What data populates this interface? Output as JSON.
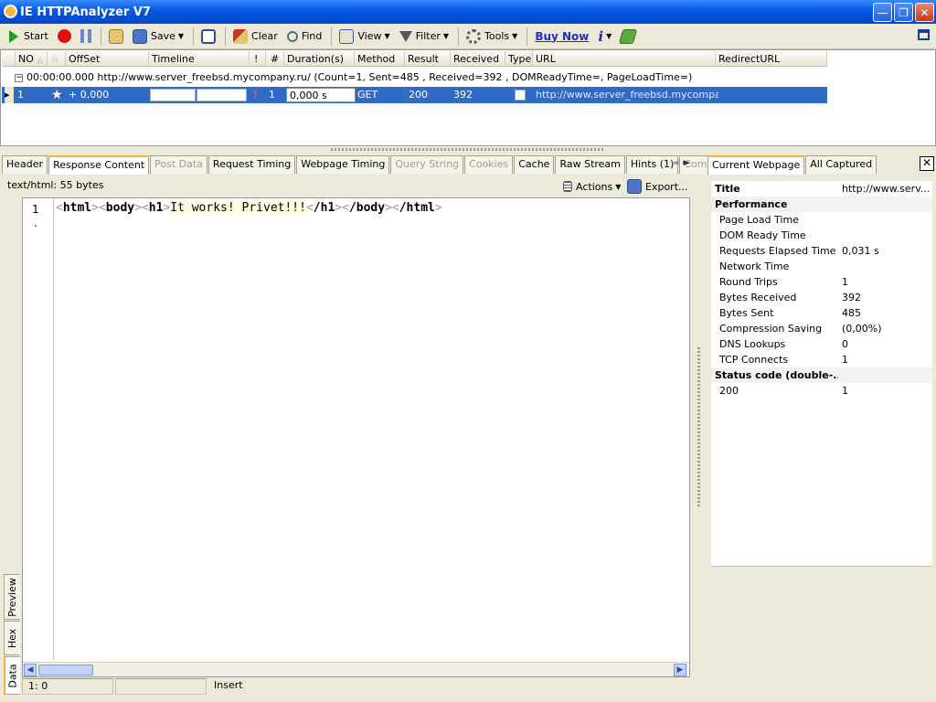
{
  "window": {
    "title": "IE HTTPAnalyzer V7"
  },
  "toolbar": {
    "start": "Start",
    "save": "Save",
    "clear": "Clear",
    "find": "Find",
    "view": "View",
    "filter": "Filter",
    "tools": "Tools",
    "buy_now": "Buy Now"
  },
  "grid": {
    "columns": [
      "NO",
      "OffSet",
      "Timeline",
      "!",
      "#",
      "Duration(s)",
      "Method",
      "Result",
      "Received",
      "Type",
      "URL",
      "RedirectURL"
    ],
    "group_row": "00:00:00.000  http://www.server_freebsd.mycompany.ru/  (Count=1, Sent=485 , Received=392 , DOMReadyTime=, PageLoadTime=)",
    "row": {
      "no": "1",
      "offset": "+ 0,000",
      "hash": "1",
      "duration": "0,000 s",
      "method": "GET",
      "result": "200",
      "received": "392",
      "url": "http://www.server_freebsd.mycompany..."
    }
  },
  "tabs": [
    "Header",
    "Response Content",
    "Post Data",
    "Request Timing",
    "Webpage Timing",
    "Query String",
    "Cookies",
    "Cache",
    "Raw Stream",
    "Hints (1)",
    "Comment"
  ],
  "tab_states": [
    "normal",
    "active",
    "disabled",
    "normal",
    "normal",
    "disabled",
    "disabled",
    "normal",
    "normal",
    "normal",
    "disabled"
  ],
  "content": {
    "info": "text/html: 55 bytes",
    "actions": "Actions",
    "export": "Export...",
    "line_number": "1",
    "code_line": "<html><body><h1>It works! Privet!!!</h1></body></html>"
  },
  "side_tabs": [
    "Preview",
    "Hex",
    "Data"
  ],
  "statusbar": {
    "position": "1: 0",
    "middle": "",
    "mode": "Insert"
  },
  "right_panel": {
    "tabs": [
      "Current Webpage",
      "All Captured"
    ],
    "rows": [
      {
        "key": "Title",
        "value": "http://www.serv...",
        "type": "title"
      },
      {
        "key": "Performance",
        "value": "",
        "type": "head"
      },
      {
        "key": "Page Load Time",
        "value": "",
        "type": "item"
      },
      {
        "key": "DOM Ready Time",
        "value": "",
        "type": "item"
      },
      {
        "key": "Requests Elapsed Time",
        "value": "0,031 s",
        "type": "item"
      },
      {
        "key": "Network Time",
        "value": "",
        "type": "item"
      },
      {
        "key": "Round Trips",
        "value": "1",
        "type": "item"
      },
      {
        "key": "Bytes Received",
        "value": "392",
        "type": "item"
      },
      {
        "key": "Bytes Sent",
        "value": "485",
        "type": "item"
      },
      {
        "key": "Compression Saving",
        "value": " (0,00%)",
        "type": "item"
      },
      {
        "key": "DNS Lookups",
        "value": "0",
        "type": "item"
      },
      {
        "key": "TCP Connects",
        "value": "1",
        "type": "item"
      },
      {
        "key": "Status code (double-...",
        "value": "",
        "type": "head"
      },
      {
        "key": "200",
        "value": "1",
        "type": "item"
      }
    ]
  },
  "colors": {
    "title_bar": "#0A5BE6",
    "selection": "#316AC5",
    "chrome": "#ECE9D8",
    "tab_accent": "#F4B440"
  }
}
